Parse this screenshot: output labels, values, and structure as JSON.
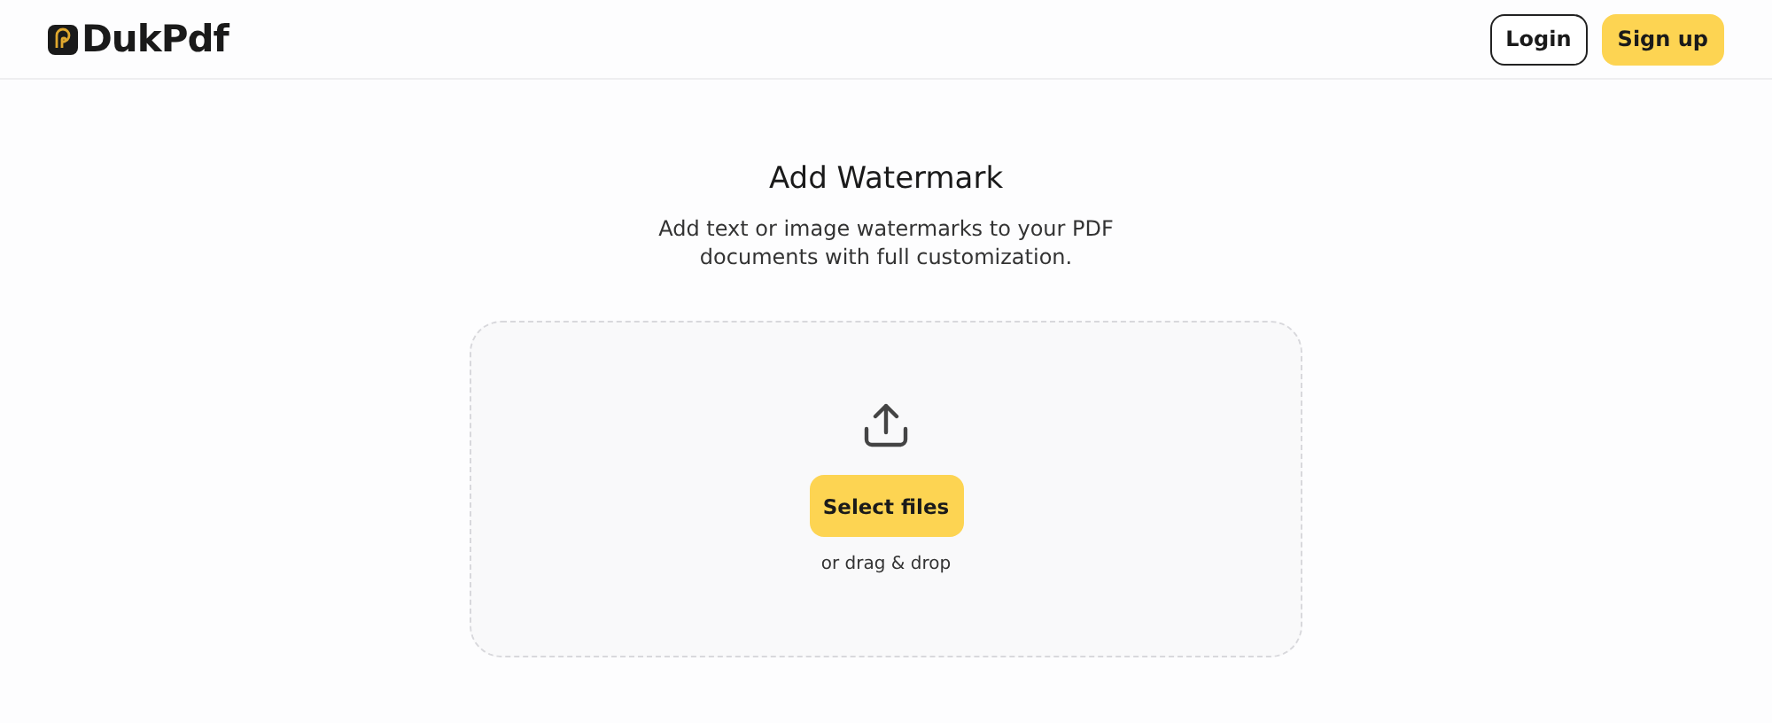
{
  "header": {
    "logo": "DukPdf",
    "buttons": [
      {
        "label": "Login",
        "kind": "outline"
      },
      {
        "label": "Sign up",
        "kind": "primary"
      }
    ]
  },
  "main": {
    "title": "Add Watermark",
    "subtitle": "Add text or image watermarks to your PDF documents with full customization.",
    "dropzone": {
      "button": "Select files",
      "hint": "or drag & drop"
    }
  }
}
